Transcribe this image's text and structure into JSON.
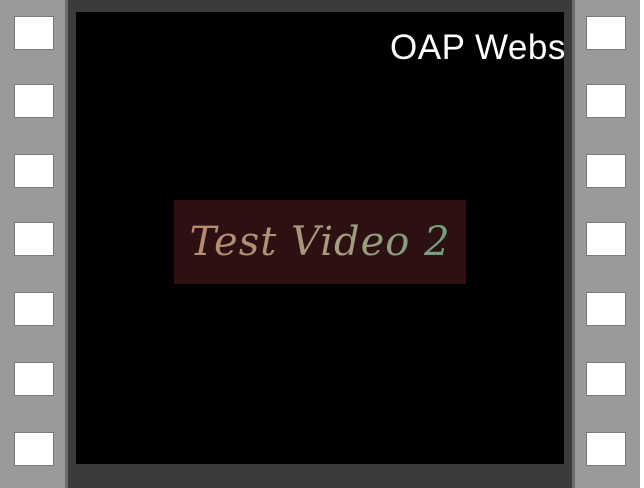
{
  "player": {
    "title": "OAP Webs",
    "card_text": "Test Video 2"
  },
  "colors": {
    "film_strip": "#9a9a9a",
    "frame": "#3b3b3b",
    "video_bg": "#000000",
    "card_bg": "#2c1012"
  },
  "sprocket_holes_per_side": 7
}
